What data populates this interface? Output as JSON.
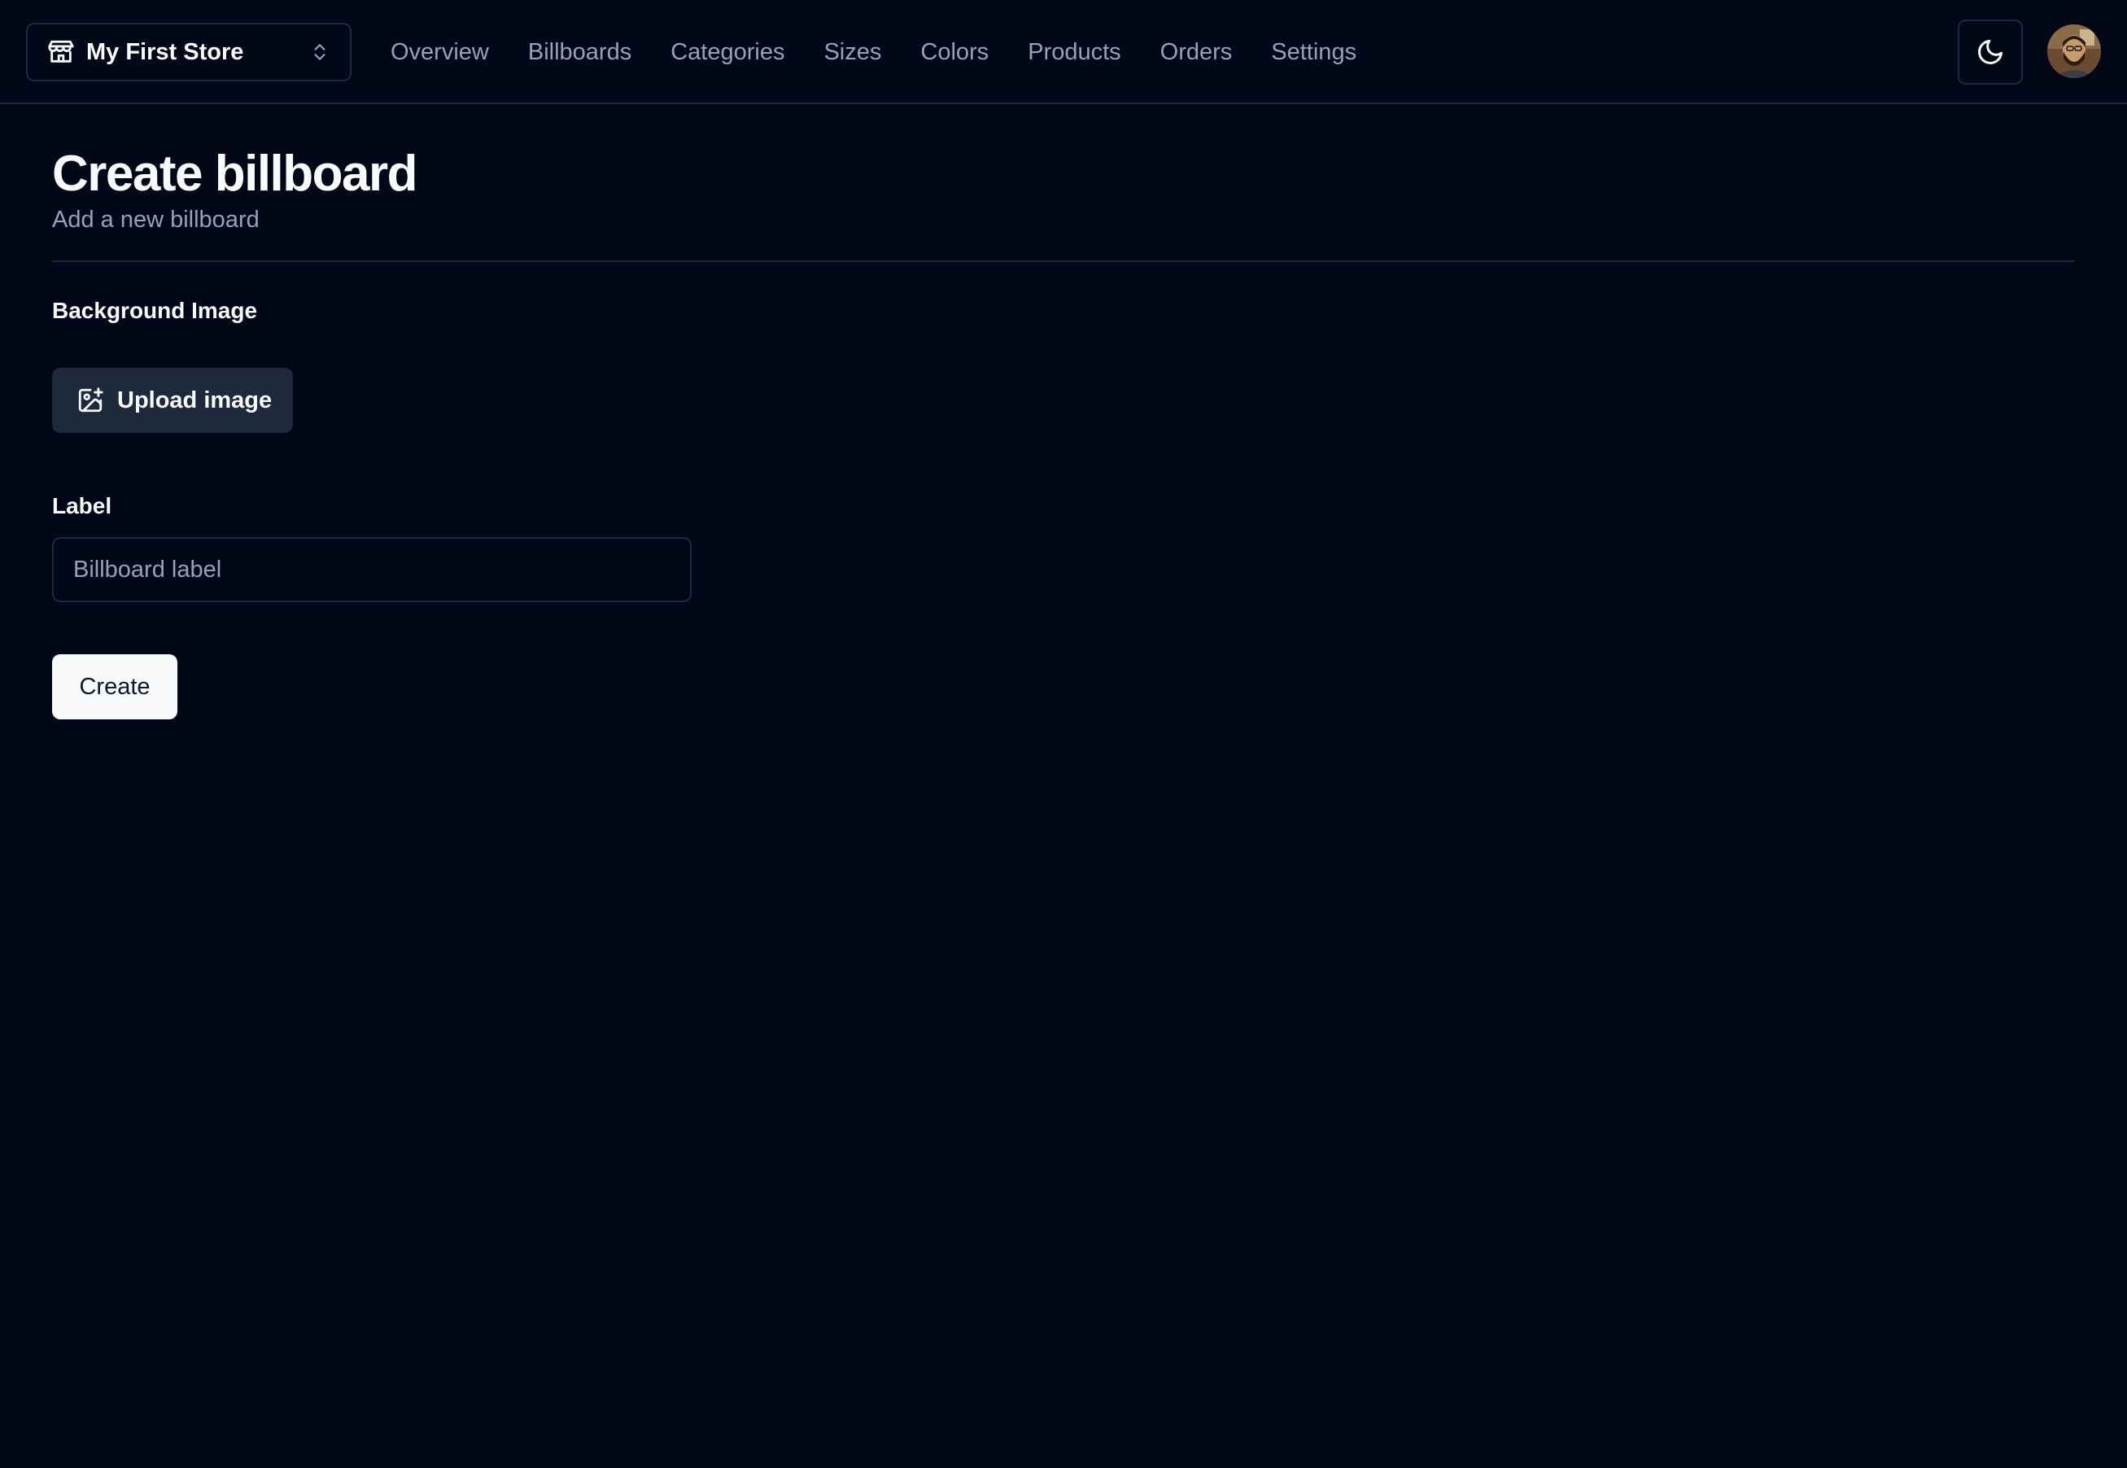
{
  "header": {
    "store_switcher": {
      "store_name": "My First Store",
      "icon": "store-icon",
      "chevron": "chevrons-up-down-icon"
    },
    "nav": [
      {
        "label": "Overview"
      },
      {
        "label": "Billboards"
      },
      {
        "label": "Categories"
      },
      {
        "label": "Sizes"
      },
      {
        "label": "Colors"
      },
      {
        "label": "Products"
      },
      {
        "label": "Orders"
      },
      {
        "label": "Settings"
      }
    ],
    "theme_toggle_icon": "moon-icon",
    "avatar_icon": "user-avatar"
  },
  "main": {
    "title": "Create billboard",
    "subtitle": "Add a new billboard",
    "background_image": {
      "label": "Background Image",
      "upload_button": "Upload image",
      "upload_icon": "image-plus-icon"
    },
    "label_field": {
      "label": "Label",
      "value": "",
      "placeholder": "Billboard label"
    },
    "submit_button": "Create"
  },
  "colors": {
    "background": "#020817",
    "border": "#1e293b",
    "muted_text": "#94a3b8",
    "foreground": "#f8fafc",
    "secondary_button": "#1e293b",
    "primary_button": "#f8fafc"
  }
}
